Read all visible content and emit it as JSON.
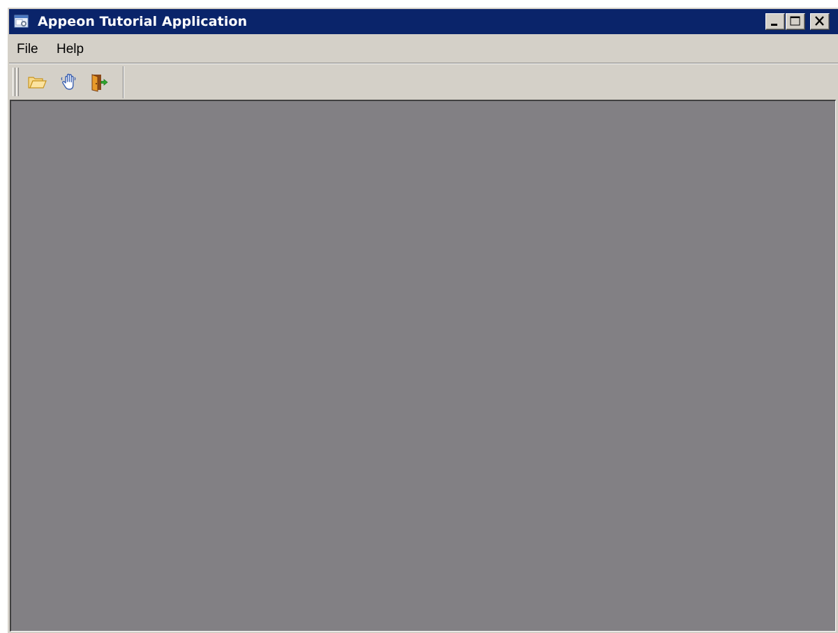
{
  "window": {
    "title": "Appeon Tutorial Application",
    "app_icon": "application-window-icon",
    "controls": {
      "minimize": "minimize-icon",
      "maximize": "maximize-icon",
      "close": "close-icon"
    },
    "titlebar_color": "#0a246a",
    "face_color": "#d4d0c8"
  },
  "menubar": {
    "items": [
      {
        "label": "File"
      },
      {
        "label": "Help"
      }
    ]
  },
  "toolbar": {
    "buttons": [
      {
        "icon": "open-folder-icon"
      },
      {
        "icon": "hand-wave-icon"
      },
      {
        "icon": "exit-door-icon"
      }
    ]
  },
  "mdi_client": {
    "background_color": "#828084"
  }
}
